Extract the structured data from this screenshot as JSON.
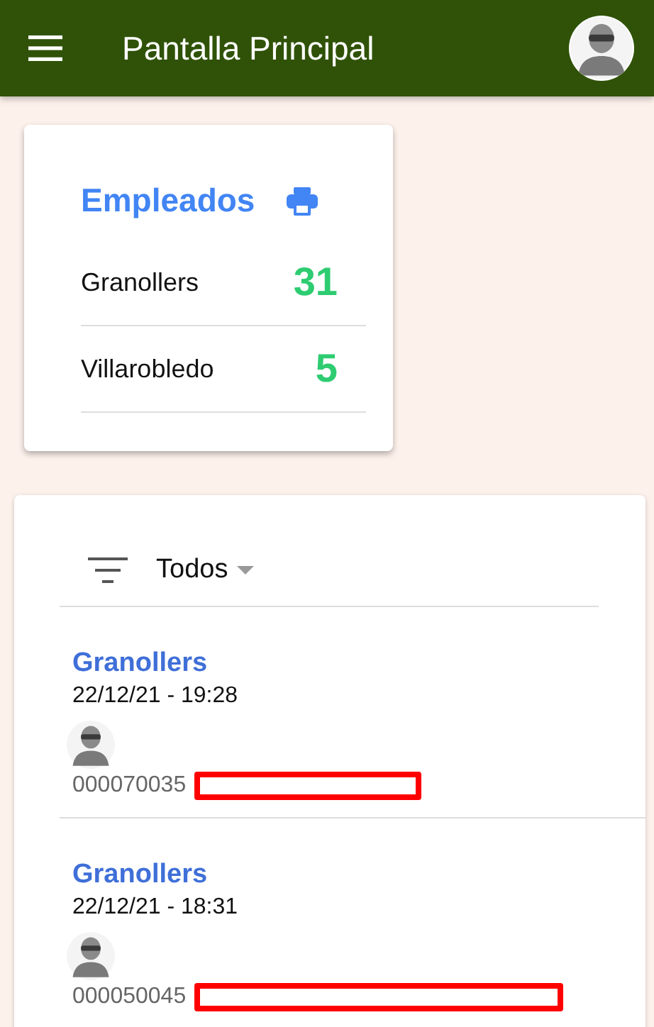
{
  "app_bar": {
    "title": "Pantalla Principal"
  },
  "employees_card": {
    "title": "Empleados",
    "rows": [
      {
        "site": "Granollers",
        "count": "31"
      },
      {
        "site": "Villarobledo",
        "count": "5"
      }
    ]
  },
  "filter": {
    "value": "Todos"
  },
  "records": [
    {
      "site": "Granollers",
      "datetime": "22/12/21 - 19:28",
      "code": "000070035",
      "redacted": true
    },
    {
      "site": "Granollers",
      "datetime": "22/12/21 - 18:31",
      "code": "000050045",
      "redacted": true
    }
  ]
}
